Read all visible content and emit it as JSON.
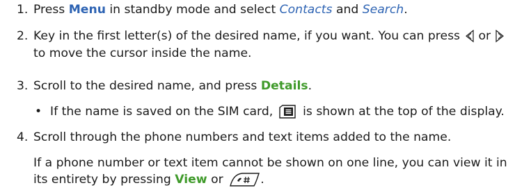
{
  "steps": [
    {
      "number": "1.",
      "parts": [
        "Press ",
        "Menu",
        " in standby mode and select ",
        "Contacts",
        " and ",
        "Search",
        "."
      ]
    },
    {
      "number": "2.",
      "line1": [
        "Key in the first letter(s) of the desired name, if you want. You can press ",
        "or"
      ],
      "line2": "to move the cursor inside the name.",
      "icons": [
        "scroll-left-icon",
        "scroll-right-icon"
      ]
    },
    {
      "number": "3.",
      "parts": [
        "Scroll to the desired name, and press ",
        "Details",
        "."
      ],
      "bullet": [
        "If the name is saved on the SIM card, ",
        " is shown at the top of the display."
      ],
      "bullet_icon": "sim-card-icon"
    },
    {
      "number": "4.",
      "line1": "Scroll through the phone numbers and text items added to the name.",
      "note1": "If a phone number or text item cannot be shown on one line, you can view it in",
      "note2": [
        "its entirety by pressing ",
        "View",
        " or ",
        "."
      ],
      "note_icon": "call-key-icon"
    }
  ],
  "colors": {
    "softkey_blue": "#2d63b3",
    "softkey_green": "#3f9a2a",
    "text": "#1a1a1a"
  }
}
